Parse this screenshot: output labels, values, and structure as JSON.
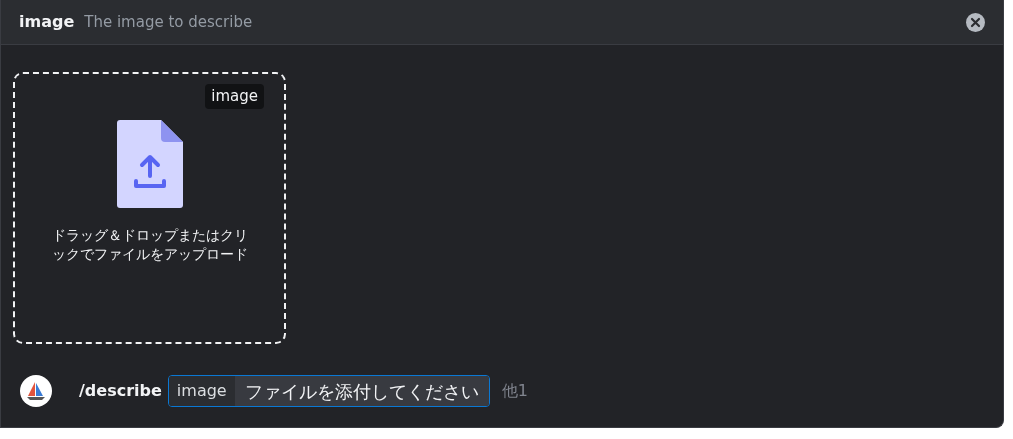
{
  "header": {
    "name": "image",
    "description": "The image to describe"
  },
  "upload": {
    "tag": "image",
    "instructions": "ドラッグ＆ドロップまたはクリックでファイルをアップロード"
  },
  "command": {
    "name": "/describe",
    "option": "image",
    "prompt": "ファイルを添付してください",
    "more": "他1"
  }
}
